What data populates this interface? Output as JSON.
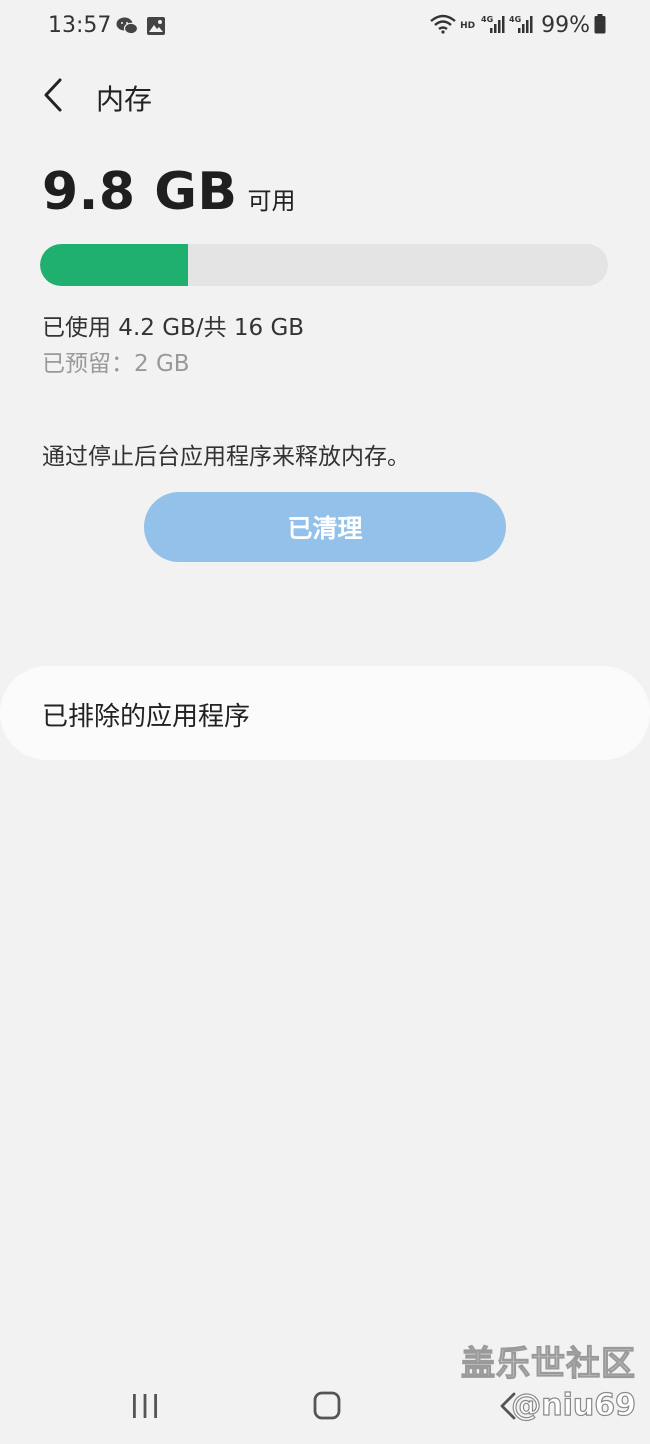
{
  "status_bar": {
    "time": "13:57",
    "left_icons": [
      "wechat-icon",
      "gallery-icon"
    ],
    "hd_label": "HD",
    "signal_labels": [
      "4G",
      "4G"
    ],
    "battery_percent": "99%"
  },
  "header": {
    "title": "内存",
    "back_icon": "chevron-left-icon"
  },
  "memory": {
    "available_value": "9.8 GB",
    "available_label": "可用",
    "used_fraction": 0.26,
    "used_text": "已使用 4.2 GB/共 16 GB",
    "reserved_text": "已预留：2 GB",
    "colors": {
      "used": "#1fb070",
      "track": "#e4e4e4"
    }
  },
  "cleanup": {
    "description": "通过停止后台应用程序来释放内存。",
    "button_label": "已清理",
    "button_color": "#93c1ea"
  },
  "excluded": {
    "label": "已排除的应用程序"
  },
  "watermark": {
    "site": "盖乐世社区",
    "user": "@niu69"
  },
  "nav_bar": {
    "items": [
      "recents-icon",
      "home-icon",
      "back-icon"
    ]
  }
}
